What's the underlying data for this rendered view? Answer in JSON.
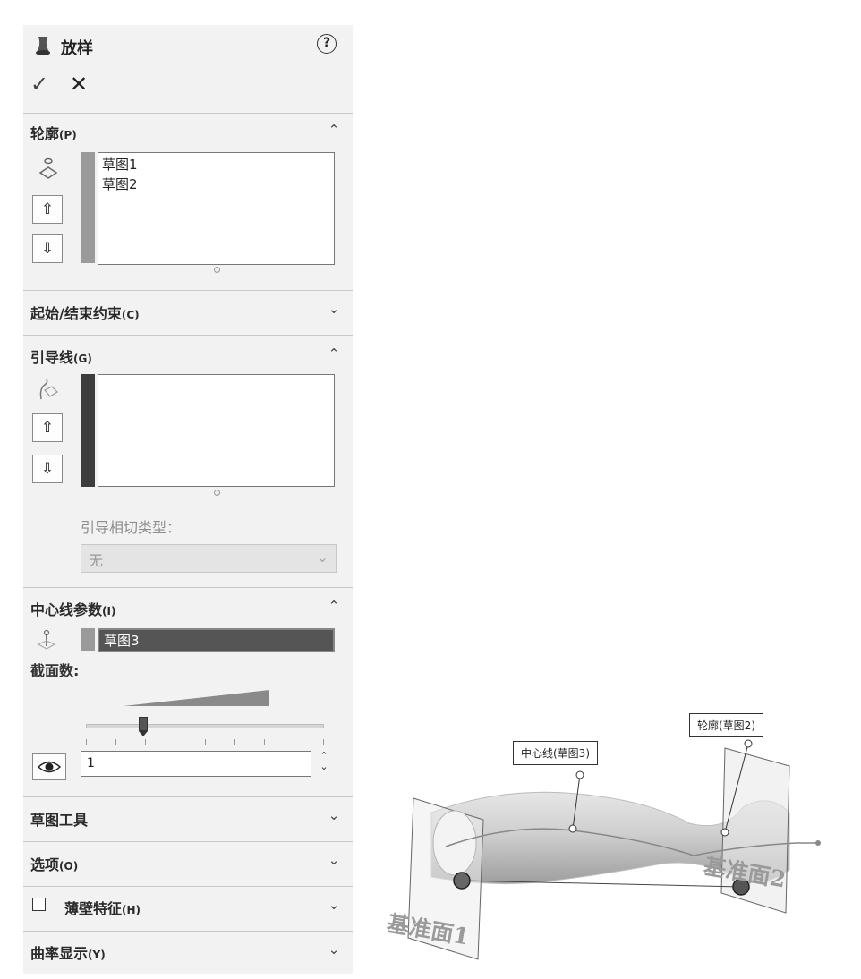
{
  "header": {
    "title": "放样"
  },
  "profile": {
    "title": "轮廓",
    "title_sub": "(P)",
    "items": [
      "草图1",
      "草图2"
    ]
  },
  "start_end": {
    "title": "起始/结束约束",
    "title_sub": "(C)"
  },
  "guides": {
    "title": "引导线",
    "title_sub": "(G)",
    "tangency_label": "引导相切类型：",
    "tangency_value": "无"
  },
  "centerline": {
    "title": "中心线参数",
    "title_sub": "(I)",
    "selected": "草图3",
    "sections_label": "截面数:",
    "sections_value": "1",
    "slider_fraction": 0.24
  },
  "sketch_tools": {
    "title": "草图工具"
  },
  "options": {
    "title": "选项",
    "title_sub": "(O)"
  },
  "thin": {
    "title": "薄壁特征",
    "title_sub": "(H)"
  },
  "curvature": {
    "title": "曲率显示",
    "title_sub": "(Y)"
  },
  "viewport": {
    "callout_centerline": "中心线(草图3)",
    "callout_profile": "轮廓(草图2)",
    "plane1": "基准面1",
    "plane2": "基准面2"
  },
  "colors": {
    "profile_bar": "#9a9a9a",
    "guide_bar": "#3d3d3d",
    "selection_bg": "#555555",
    "panel_bg": "#f2f2f2"
  }
}
